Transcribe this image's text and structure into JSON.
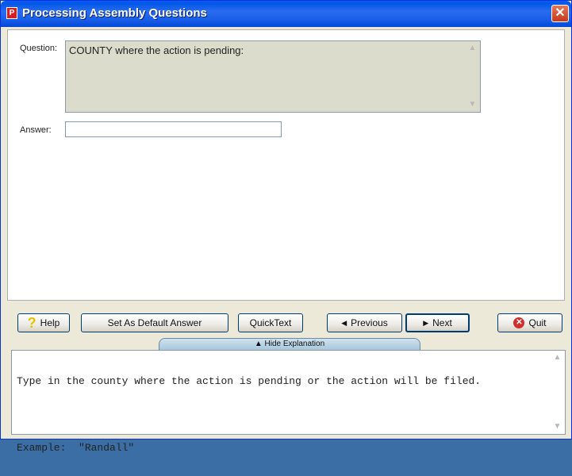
{
  "window": {
    "title": "Processing Assembly Questions",
    "app_icon_letter": "P",
    "close_glyph": "✕"
  },
  "question": {
    "label": "Question:",
    "text": "COUNTY where the action is pending:"
  },
  "answer": {
    "label": "Answer:",
    "value": ""
  },
  "buttons": {
    "help": "Help",
    "set_default": "Set As Default Answer",
    "quicktext": "QuickText",
    "previous": "Previous",
    "next": "Next",
    "quit": "Quit"
  },
  "explanation": {
    "toggle_label": "Hide Explanation",
    "line1": "Type in the county where the action is pending or the action will be filed.",
    "line2": "Example:  \"Randall\""
  },
  "icons": {
    "help": "help-icon",
    "quit": "quit-icon",
    "previous": "left-triangle-icon",
    "next": "right-triangle-icon"
  },
  "colors": {
    "title_bar": "#0058e6",
    "question_bg": "#dcdccc",
    "hide_bar": "#a7c7dc"
  }
}
